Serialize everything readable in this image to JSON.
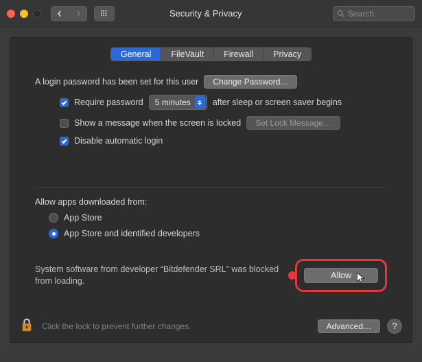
{
  "window": {
    "title": "Security & Privacy",
    "search_placeholder": "Search"
  },
  "tabs": {
    "general": "General",
    "filevault": "FileVault",
    "firewall": "Firewall",
    "privacy": "Privacy"
  },
  "login": {
    "password_set_text": "A login password has been set for this user",
    "change_password": "Change Password…",
    "require_password_label": "Require password",
    "require_password_delay": "5 minutes",
    "after_sleep_text": "after sleep or screen saver begins",
    "show_message_label": "Show a message when the screen is locked",
    "set_lock_message": "Set Lock Message…",
    "disable_auto_login": "Disable automatic login"
  },
  "downloads": {
    "heading": "Allow apps downloaded from:",
    "app_store": "App Store",
    "app_store_identified": "App Store and identified developers"
  },
  "blocked": {
    "message": "System software from developer “Bitdefender SRL” was blocked from loading.",
    "allow": "Allow"
  },
  "footer": {
    "lock_text": "Click the lock to prevent further changes.",
    "advanced": "Advanced…",
    "help": "?"
  },
  "state": {
    "require_password_checked": true,
    "show_message_checked": false,
    "disable_auto_login_checked": true,
    "download_option": "identified"
  }
}
